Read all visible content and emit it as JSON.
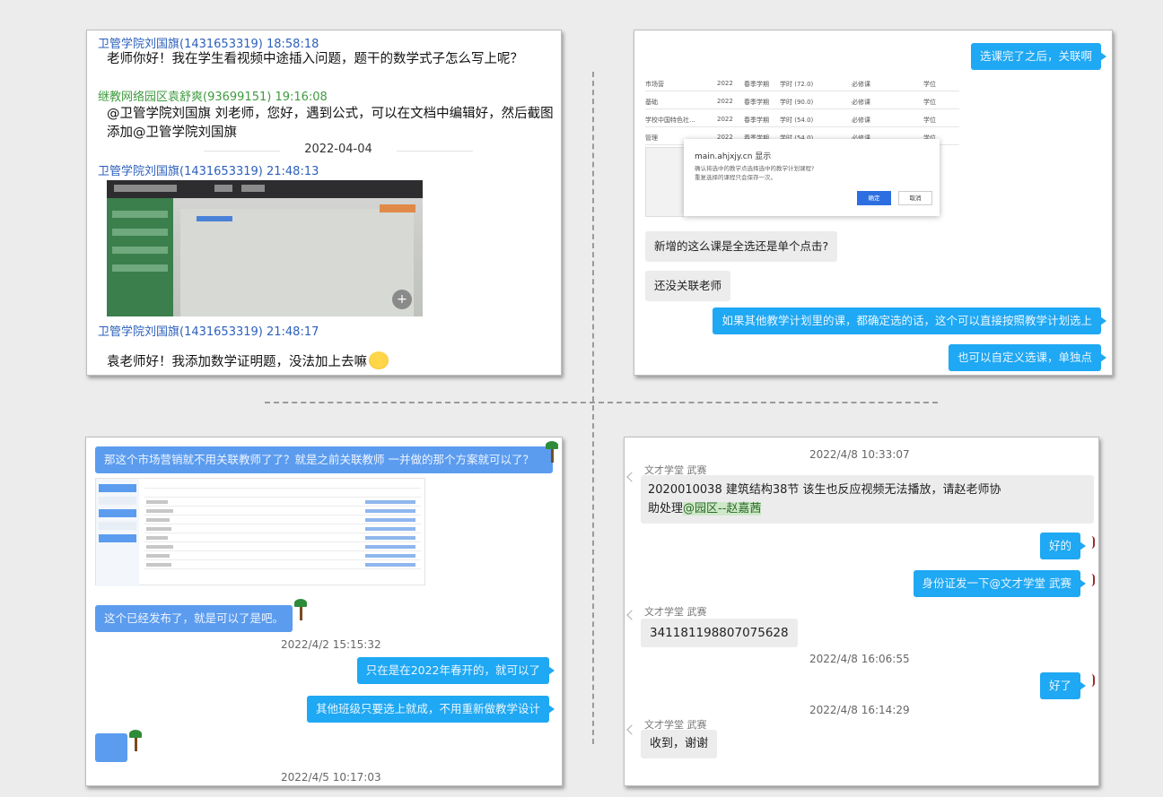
{
  "panel1": {
    "msg1_header": "卫管学院刘国旗(1431653319) 18:58:18",
    "msg1_text": "老师你好！我在学生看视频中途插入问题，题干的数学式子怎么写上呢？",
    "msg2_header": "继教网络园区袁舒爽(93699151) 19:16:08",
    "msg2_text": "@卫管学院刘国旗 刘老师，您好，遇到公式，可以在文档中编辑好，然后截图添加@卫管学院刘国旗",
    "date": "2022-04-04",
    "msg3_header": "卫管学院刘国旗(1431653319) 21:48:13",
    "msg4_header": "卫管学院刘国旗(1431653319) 21:48:17",
    "msg4_text": "袁老师好！我添加数学证明题，没法加上去嘛",
    "zoom_glyph": "+"
  },
  "panel2": {
    "bubble1": "选课完了之后，关联啊",
    "table_rows": [
      [
        "市场营",
        "2022",
        "春季学期",
        "学时 (72.0)",
        "必修课",
        "学位"
      ],
      [
        "基础",
        "2022",
        "春季学期",
        "学时 (90.0)",
        "必修课",
        "学位"
      ],
      [
        "学校中国特色社...",
        "2022",
        "春季学期",
        "学时 (54.0)",
        "必修课",
        "学位"
      ],
      [
        "管理",
        "2022",
        "春季学期",
        "学时 (54.0)",
        "必修课",
        "学位"
      ]
    ],
    "dialog_title": "main.ahjxjy.cn 显示",
    "dialog_text1": "确认将选中的教学点选择选中的教学计划课程?",
    "dialog_text2": "重复选择的课程只会保存一次。",
    "dialog_ok": "确定",
    "dialog_cancel": "取消",
    "bubble2": "新增的这么课是全选还是单个点击?",
    "bubble3": "还没关联老师",
    "bubble4": "如果其他教学计划里的课，都确定选的话，这个可以直接按照教学计划选上",
    "bubble5": "也可以自定义选课，单独点"
  },
  "panel3": {
    "bubble1": "那这个市场营销就不用关联教师了了？就是之前关联教师 一并做的那个方案就可以了？",
    "bubble2": "这个已经发布了，就是可以了是吧。",
    "ts1": "2022/4/2 15:15:32",
    "bubble3": "只在是在2022年春开的，就可以了",
    "bubble4": "其他班级只要选上就成，不用重新做教学设计",
    "ts2": "2022/4/5 10:17:03"
  },
  "panel4": {
    "ts1": "2022/4/8 10:33:07",
    "sender1": "文才学堂 武赛",
    "bubble1_line1": "2020010038 建筑结构38节 该生也反应视频无法播放，请赵老师协",
    "bubble1_line2_pre": "助处理",
    "bubble1_mention": "@园区--赵嘉茜",
    "reply1": "好的",
    "reply2": "身份证发一下@文才学堂 武赛",
    "sender2": "文才学堂 武赛",
    "idnum": "341181198807075628",
    "ts2": "2022/4/8 16:06:55",
    "reply3": "好了",
    "ts3": "2022/4/8 16:14:29",
    "sender3": "文才学堂 武赛",
    "bubble_last": "收到，谢谢"
  }
}
